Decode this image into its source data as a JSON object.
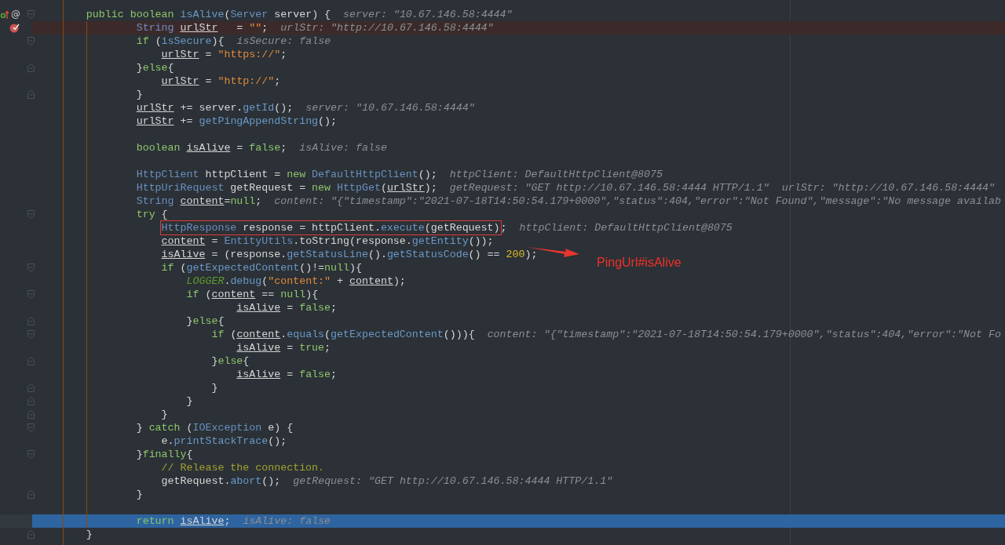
{
  "lines": [
    {
      "tokens": [
        {
          "text": "        public boolean ",
          "kind": "kw"
        },
        {
          "text": "isAlive",
          "kind": "method"
        },
        {
          "text": "(",
          "kind": "p"
        },
        {
          "text": "Server",
          "kind": "type"
        },
        {
          "text": " server) {",
          "kind": "p"
        }
      ],
      "hints": [
        "server: \"10.67.146.58:4444\""
      ],
      "fold_start": true,
      "gutter": [
        {
          "kind": "override"
        },
        {
          "kind": "annotation",
          "text": "@"
        }
      ]
    },
    {
      "tokens": [
        {
          "text": "                String ",
          "kind": "type"
        },
        {
          "text": "urlStr",
          "kind": "var"
        },
        {
          "text": "   = ",
          "kind": "p"
        },
        {
          "text": "\"\"",
          "kind": "str"
        },
        {
          "text": ";",
          "kind": "p"
        }
      ],
      "hints": [
        "urlStr: \"http://10.67.146.58:4444\""
      ],
      "breakpoint": true,
      "gutter": [
        {
          "kind": "breakpoint"
        }
      ]
    },
    {
      "tokens": [
        {
          "text": "                if ",
          "kind": "kw"
        },
        {
          "text": "(",
          "kind": "p"
        },
        {
          "text": "isSecure",
          "kind": "field"
        },
        {
          "text": "){",
          "kind": "p"
        }
      ],
      "hints": [
        "isSecure: false"
      ],
      "fold_start": true
    },
    {
      "tokens": [
        {
          "text": "                    urlStr",
          "kind": "var"
        },
        {
          "text": " = ",
          "kind": "p"
        },
        {
          "text": "\"https://\"",
          "kind": "str"
        },
        {
          "text": ";",
          "kind": "p"
        }
      ]
    },
    {
      "tokens": [
        {
          "text": "                }",
          "kind": "p"
        },
        {
          "text": "else",
          "kind": "kw"
        },
        {
          "text": "{",
          "kind": "p"
        }
      ],
      "fold_end": true
    },
    {
      "tokens": [
        {
          "text": "                    urlStr",
          "kind": "var"
        },
        {
          "text": " = ",
          "kind": "p"
        },
        {
          "text": "\"http://\"",
          "kind": "str"
        },
        {
          "text": ";",
          "kind": "p"
        }
      ]
    },
    {
      "tokens": [
        {
          "text": "                }",
          "kind": "p"
        }
      ],
      "fold_end": true
    },
    {
      "tokens": [
        {
          "text": "                urlStr",
          "kind": "var"
        },
        {
          "text": " += server.",
          "kind": "p"
        },
        {
          "text": "getId",
          "kind": "method"
        },
        {
          "text": "();",
          "kind": "p"
        }
      ],
      "hints": [
        "server: \"10.67.146.58:4444\""
      ]
    },
    {
      "tokens": [
        {
          "text": "                urlStr",
          "kind": "var"
        },
        {
          "text": " += ",
          "kind": "p"
        },
        {
          "text": "getPingAppendString",
          "kind": "method"
        },
        {
          "text": "();",
          "kind": "p"
        }
      ]
    },
    {
      "blank_before": true,
      "tokens": [
        {
          "text": "                boolean ",
          "kind": "kw"
        },
        {
          "text": "isAlive",
          "kind": "var"
        },
        {
          "text": " = ",
          "kind": "p"
        },
        {
          "text": "false",
          "kind": "kw"
        },
        {
          "text": ";",
          "kind": "p"
        }
      ],
      "hints": [
        "isAlive: false"
      ]
    },
    {
      "blank_before": true,
      "tokens": [
        {
          "text": "                HttpClient",
          "kind": "type"
        },
        {
          "text": " httpClient = ",
          "kind": "p"
        },
        {
          "text": "new ",
          "kind": "kw"
        },
        {
          "text": "DefaultHttpClient",
          "kind": "type"
        },
        {
          "text": "();",
          "kind": "p"
        }
      ],
      "hints": [
        "httpClient: DefaultHttpClient@8075"
      ]
    },
    {
      "tokens": [
        {
          "text": "                HttpUriRequest",
          "kind": "type"
        },
        {
          "text": " getRequest = ",
          "kind": "p"
        },
        {
          "text": "new ",
          "kind": "kw"
        },
        {
          "text": "HttpGet",
          "kind": "type"
        },
        {
          "text": "(",
          "kind": "p"
        },
        {
          "text": "urlStr",
          "kind": "var"
        },
        {
          "text": ");",
          "kind": "p"
        }
      ],
      "hints": [
        "getRequest: \"GET http://10.67.146.58:4444 HTTP/1.1\"",
        "urlStr: \"http://10.67.146.58:4444\""
      ]
    },
    {
      "tokens": [
        {
          "text": "                String ",
          "kind": "type"
        },
        {
          "text": "content",
          "kind": "var"
        },
        {
          "text": "=",
          "kind": "p"
        },
        {
          "text": "null",
          "kind": "kw"
        },
        {
          "text": ";",
          "kind": "p"
        }
      ],
      "hints": [
        "content: \"{\"timestamp\":\"2021-07-18T14:50:54.179+0000\",\"status\":404,\"error\":\"Not Found\",\"message\":\"No message availab"
      ]
    },
    {
      "tokens": [
        {
          "text": "                try ",
          "kind": "kw"
        },
        {
          "text": "{",
          "kind": "p"
        }
      ],
      "fold_start": true
    },
    {
      "tokens": [
        {
          "text": "                    HttpResponse",
          "kind": "type"
        },
        {
          "text": " response = httpClient.",
          "kind": "p"
        },
        {
          "text": "execute",
          "kind": "method"
        },
        {
          "text": "(getRequest)",
          "kind": "p"
        },
        {
          "text": ";",
          "kind": "p"
        }
      ],
      "hints": [
        "httpClient: DefaultHttpClient@8075"
      ],
      "boxed": true
    },
    {
      "tokens": [
        {
          "text": "                    content",
          "kind": "var"
        },
        {
          "text": " = ",
          "kind": "p"
        },
        {
          "text": "EntityUtils",
          "kind": "type"
        },
        {
          "text": ".toString(response.",
          "kind": "p"
        },
        {
          "text": "getEntity",
          "kind": "method"
        },
        {
          "text": "());",
          "kind": "p"
        }
      ]
    },
    {
      "tokens": [
        {
          "text": "                    isAlive",
          "kind": "var"
        },
        {
          "text": " = (response.",
          "kind": "p"
        },
        {
          "text": "getStatusLine",
          "kind": "method"
        },
        {
          "text": "().",
          "kind": "p"
        },
        {
          "text": "getStatusCode",
          "kind": "method"
        },
        {
          "text": "() == ",
          "kind": "p"
        },
        {
          "text": "200",
          "kind": "num"
        },
        {
          "text": ");",
          "kind": "p"
        }
      ]
    },
    {
      "tokens": [
        {
          "text": "                    if ",
          "kind": "kw"
        },
        {
          "text": "(",
          "kind": "p"
        },
        {
          "text": "getExpectedContent",
          "kind": "method"
        },
        {
          "text": "()!=",
          "kind": "p"
        },
        {
          "text": "null",
          "kind": "kw"
        },
        {
          "text": "){",
          "kind": "p"
        }
      ],
      "fold_start": true
    },
    {
      "tokens": [
        {
          "text": "                        LOGGER",
          "kind": "static"
        },
        {
          "text": ".",
          "kind": "p"
        },
        {
          "text": "debug",
          "kind": "method"
        },
        {
          "text": "(",
          "kind": "p"
        },
        {
          "text": "\"content:\"",
          "kind": "str"
        },
        {
          "text": " + ",
          "kind": "p"
        },
        {
          "text": "content",
          "kind": "var"
        },
        {
          "text": ");",
          "kind": "p"
        }
      ]
    },
    {
      "tokens": [
        {
          "text": "                        if ",
          "kind": "kw"
        },
        {
          "text": "(",
          "kind": "p"
        },
        {
          "text": "content",
          "kind": "var"
        },
        {
          "text": " == ",
          "kind": "p"
        },
        {
          "text": "null",
          "kind": "kw"
        },
        {
          "text": "){",
          "kind": "p"
        }
      ],
      "fold_start": true
    },
    {
      "tokens": [
        {
          "text": "                                isAlive",
          "kind": "var"
        },
        {
          "text": " = ",
          "kind": "p"
        },
        {
          "text": "false",
          "kind": "kw"
        },
        {
          "text": ";",
          "kind": "p"
        }
      ]
    },
    {
      "tokens": [
        {
          "text": "                        }",
          "kind": "p"
        },
        {
          "text": "else",
          "kind": "kw"
        },
        {
          "text": "{",
          "kind": "p"
        }
      ],
      "fold_end": true
    },
    {
      "tokens": [
        {
          "text": "                            if ",
          "kind": "kw"
        },
        {
          "text": "(",
          "kind": "p"
        },
        {
          "text": "content",
          "kind": "var"
        },
        {
          "text": ".",
          "kind": "p"
        },
        {
          "text": "equals",
          "kind": "method"
        },
        {
          "text": "(",
          "kind": "p"
        },
        {
          "text": "getExpectedContent",
          "kind": "method"
        },
        {
          "text": "())){",
          "kind": "p"
        }
      ],
      "hints": [
        "content: \"{\"timestamp\":\"2021-07-18T14:50:54.179+0000\",\"status\":404,\"error\":\"Not Fo"
      ],
      "fold_start": true
    },
    {
      "tokens": [
        {
          "text": "                                isAlive",
          "kind": "var"
        },
        {
          "text": " = ",
          "kind": "p"
        },
        {
          "text": "true",
          "kind": "kw"
        },
        {
          "text": ";",
          "kind": "p"
        }
      ]
    },
    {
      "tokens": [
        {
          "text": "                            }",
          "kind": "p"
        },
        {
          "text": "else",
          "kind": "kw"
        },
        {
          "text": "{",
          "kind": "p"
        }
      ],
      "fold_end": true
    },
    {
      "tokens": [
        {
          "text": "                                isAlive",
          "kind": "var"
        },
        {
          "text": " = ",
          "kind": "p"
        },
        {
          "text": "false",
          "kind": "kw"
        },
        {
          "text": ";",
          "kind": "p"
        }
      ]
    },
    {
      "tokens": [
        {
          "text": "                            }",
          "kind": "p"
        }
      ],
      "fold_end": true
    },
    {
      "tokens": [
        {
          "text": "                        }",
          "kind": "p"
        }
      ],
      "fold_end": true
    },
    {
      "tokens": [
        {
          "text": "                    }",
          "kind": "p"
        }
      ],
      "fold_end": true
    },
    {
      "tokens": [
        {
          "text": "                } ",
          "kind": "p"
        },
        {
          "text": "catch ",
          "kind": "kw"
        },
        {
          "text": "(",
          "kind": "p"
        },
        {
          "text": "IOException",
          "kind": "type"
        },
        {
          "text": " e) {",
          "kind": "p"
        }
      ],
      "fold_start": true
    },
    {
      "tokens": [
        {
          "text": "                    e.",
          "kind": "p"
        },
        {
          "text": "printStackTrace",
          "kind": "method"
        },
        {
          "text": "();",
          "kind": "p"
        }
      ]
    },
    {
      "tokens": [
        {
          "text": "                }",
          "kind": "p"
        },
        {
          "text": "finally",
          "kind": "kw"
        },
        {
          "text": "{",
          "kind": "p"
        }
      ],
      "fold_start": true
    },
    {
      "tokens": [
        {
          "text": "                    // Release the connection.",
          "kind": "comment"
        }
      ]
    },
    {
      "tokens": [
        {
          "text": "                    getRequest.",
          "kind": "p"
        },
        {
          "text": "abort",
          "kind": "method"
        },
        {
          "text": "();",
          "kind": "p"
        }
      ],
      "hints": [
        "getRequest: \"GET http://10.67.146.58:4444 HTTP/1.1\""
      ]
    },
    {
      "tokens": [
        {
          "text": "                }",
          "kind": "p"
        }
      ],
      "fold_end": true
    },
    {
      "blank_before": true,
      "tokens": [
        {
          "text": "                return ",
          "kind": "kw"
        },
        {
          "text": "isAlive",
          "kind": "var"
        },
        {
          "text": ";",
          "kind": "p"
        }
      ],
      "hints": [
        "isAlive: false"
      ],
      "execution_point": true
    },
    {
      "tokens": [
        {
          "text": "        }",
          "kind": "p"
        }
      ],
      "fold_end": true
    }
  ],
  "annotation": {
    "label": "PingUrl#isAlive"
  }
}
